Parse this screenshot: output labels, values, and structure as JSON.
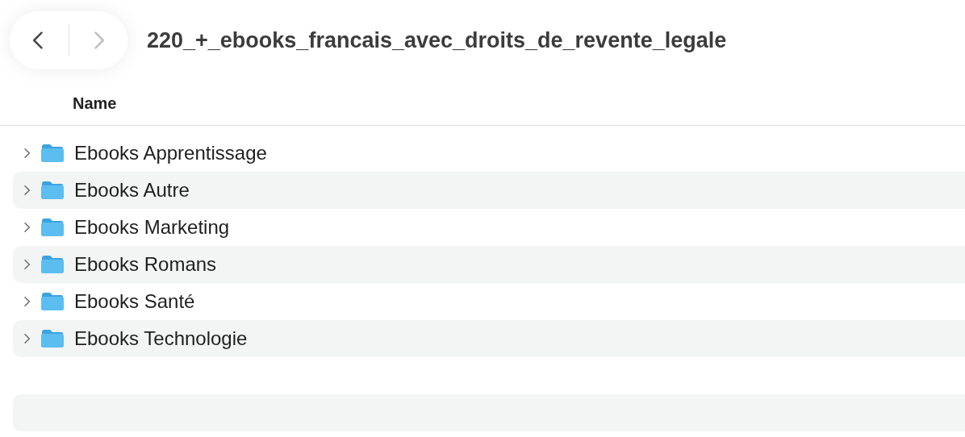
{
  "toolbar": {
    "back": {
      "disabled": false
    },
    "forward": {
      "disabled": true
    },
    "title": "220_+_ebooks_francais_avec_droits_de_revente_legale"
  },
  "table": {
    "columns": [
      "Name"
    ],
    "rows": [
      {
        "name": "Ebooks Apprentissage",
        "expanded": false
      },
      {
        "name": "Ebooks Autre",
        "expanded": false
      },
      {
        "name": "Ebooks Marketing",
        "expanded": false
      },
      {
        "name": "Ebooks Romans",
        "expanded": false
      },
      {
        "name": "Ebooks Santé",
        "expanded": false
      },
      {
        "name": "Ebooks Technologie",
        "expanded": false
      }
    ]
  }
}
